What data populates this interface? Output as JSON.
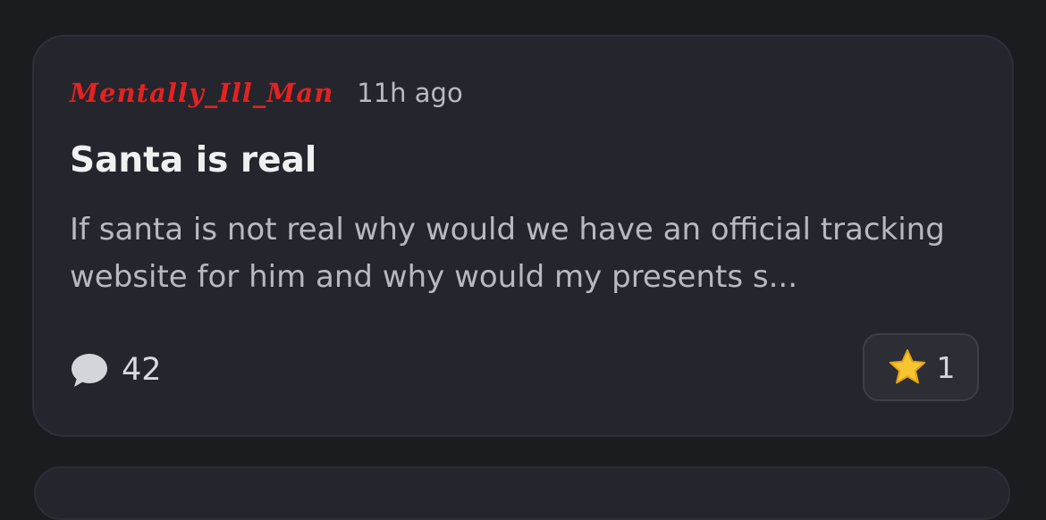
{
  "post": {
    "author": "Mentally_Ill_Man",
    "time": "11h ago",
    "title": "Santa is real",
    "body": "If santa is not real why would we have an official tracking website for him and why would my presents s...",
    "comments": {
      "icon": "speech-bubble-icon",
      "count": "42"
    },
    "reaction": {
      "emoji": "star-icon",
      "count": "1"
    }
  },
  "colors": {
    "background": "#1b1c20",
    "card": "#25262d",
    "author": "#e32222",
    "title": "#f0f0f2",
    "body": "#b8b9bf",
    "star": "#f7c531"
  }
}
